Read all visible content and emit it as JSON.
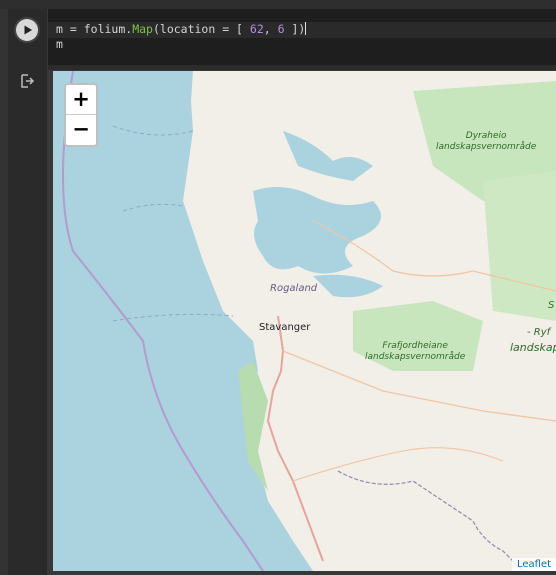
{
  "notebook": {
    "code_lines": [
      {
        "var": "m",
        "op": " = ",
        "mod": "folium.",
        "fn": "Map",
        "args_open": "(location = [ ",
        "lat": "62",
        "comma": ", ",
        "lon": "6",
        "args_close": " ])"
      },
      {
        "text": "m"
      }
    ],
    "run_icon": "play-icon",
    "output_icon": "output-arrow-icon"
  },
  "map": {
    "zoom_in": "+",
    "zoom_out": "−",
    "attribution": "Leaflet",
    "labels": {
      "region": "Rogaland",
      "city": "Stavanger",
      "park1_line1": "Dyraheio",
      "park1_line2": "landskapsvernområde",
      "park2_line1": "Frafjordheiane",
      "park2_line2": "landskapsvernområde",
      "edge1": "S",
      "edge2": "- Ryf",
      "edge3": "landskap"
    },
    "colors": {
      "water": "#aad3df",
      "land": "#f2efe9",
      "park": "#c8e6bd",
      "road": "#e8a39a",
      "border": "#b49ad0",
      "link": "#0078a8"
    }
  }
}
